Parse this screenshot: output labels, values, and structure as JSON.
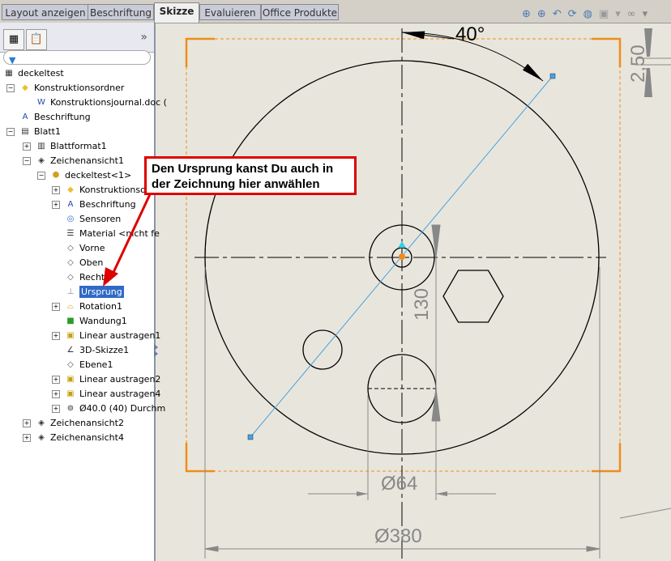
{
  "tabs": [
    {
      "label": "Layout anzeigen"
    },
    {
      "label": "Beschriftung"
    },
    {
      "label": "Skizze",
      "active": true
    },
    {
      "label": "Evaluieren"
    },
    {
      "label": "Office Produkte"
    }
  ],
  "toolbar_icons": [
    "zoom-fit-icon",
    "zoom-area-icon",
    "previous-view-icon",
    "redraw-icon",
    "hide-show-icon",
    "display-style-icon",
    "view-settings-icon"
  ],
  "tree": {
    "items": [
      {
        "label": "deckeltest",
        "level": 0,
        "icon": "drawing-icon"
      },
      {
        "label": "Konstruktionsordner",
        "level": 1,
        "icon": "folder-icon",
        "pm": "-"
      },
      {
        "label": "Konstruktionsjournal.doc (",
        "level": 2,
        "icon": "word-doc-icon"
      },
      {
        "label": "Beschriftung",
        "level": 1,
        "icon": "annotation-icon"
      },
      {
        "label": "Blatt1",
        "level": 1,
        "icon": "sheet-icon",
        "pm": "-"
      },
      {
        "label": "Blattformat1",
        "level": 2,
        "icon": "sheet-format-icon",
        "pm": "+"
      },
      {
        "label": "Zeichenansicht1",
        "level": 2,
        "icon": "drawing-view-icon",
        "pm": "-"
      },
      {
        "label": "deckeltest<1>",
        "level": 3,
        "icon": "part-icon",
        "pm": "-"
      },
      {
        "label": "Konstruktionsord",
        "level": 4,
        "icon": "folder-icon",
        "pm": "+"
      },
      {
        "label": "Beschriftung",
        "level": 4,
        "icon": "annotation-icon",
        "pm": "+"
      },
      {
        "label": "Sensoren",
        "level": 4,
        "icon": "sensor-icon"
      },
      {
        "label": "Material <nicht fe",
        "level": 4,
        "icon": "material-icon"
      },
      {
        "label": "Vorne",
        "level": 4,
        "icon": "plane-icon"
      },
      {
        "label": "Oben",
        "level": 4,
        "icon": "plane-icon"
      },
      {
        "label": "Rechts",
        "level": 4,
        "icon": "plane-icon"
      },
      {
        "label": "Ursprung",
        "level": 4,
        "icon": "origin-icon",
        "selected": true
      },
      {
        "label": "Rotation1",
        "level": 4,
        "icon": "revolve-icon",
        "pm": "+"
      },
      {
        "label": "Wandung1",
        "level": 4,
        "icon": "shell-icon"
      },
      {
        "label": "Linear austragen1",
        "level": 4,
        "icon": "extrude-icon",
        "pm": "+"
      },
      {
        "label": "3D-Skizze1",
        "level": 4,
        "icon": "3d-sketch-icon"
      },
      {
        "label": "Ebene1",
        "level": 4,
        "icon": "plane-icon"
      },
      {
        "label": "Linear austragen2",
        "level": 4,
        "icon": "extrude-icon",
        "pm": "+"
      },
      {
        "label": "Linear austragen4",
        "level": 4,
        "icon": "extrude-icon",
        "pm": "+"
      },
      {
        "label": "Ø40.0 (40) Durchm",
        "level": 4,
        "icon": "hole-icon",
        "pm": "+"
      },
      {
        "label": "Zeichenansicht2",
        "level": 2,
        "icon": "drawing-view-icon",
        "pm": "+"
      },
      {
        "label": "Zeichenansicht4",
        "level": 2,
        "icon": "drawing-view-icon",
        "pm": "+"
      }
    ]
  },
  "callout": {
    "line1": "Den Ursprung kanst Du auch in",
    "line2": "der Zeichnung hier anwählen"
  },
  "dimensions": {
    "angle": "40°",
    "vertical": "130",
    "small_dia": "Ø64",
    "large_dia": "Ø380",
    "right": "2,50"
  },
  "colors": {
    "frame": "#f08c1e",
    "callout_border": "#dd0000",
    "selection": "#316ac5",
    "sketch_line": "#4aa0e0"
  }
}
